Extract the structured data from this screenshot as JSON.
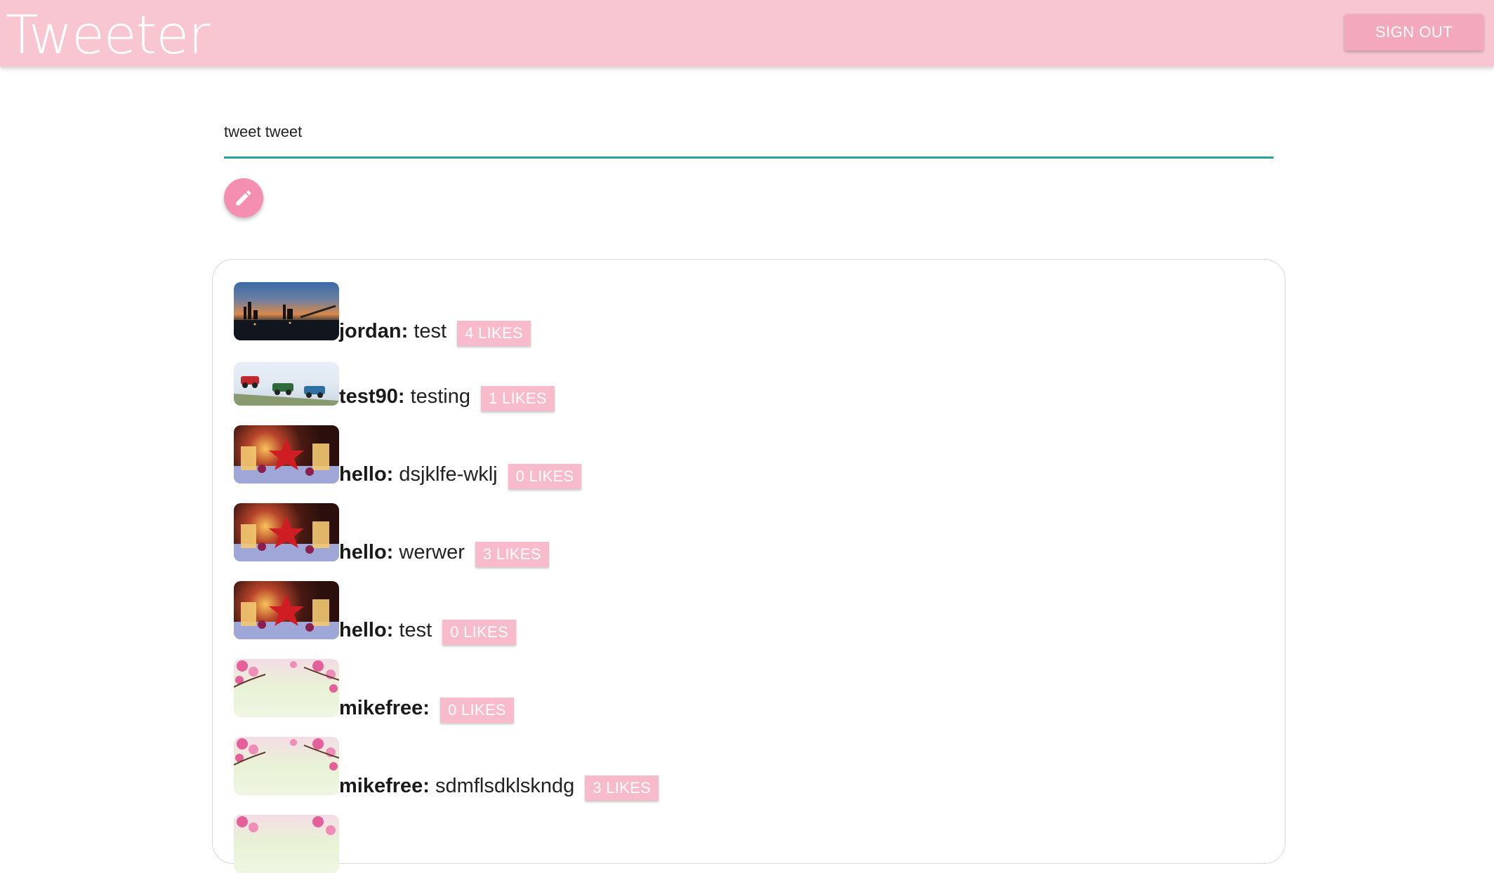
{
  "app": {
    "title": "Tweeter",
    "sign_out_label": "SIGN OUT"
  },
  "composer": {
    "value": "tweet tweet",
    "post_icon": "pencil-icon"
  },
  "feed": {
    "tweets": [
      {
        "user": "jordan:",
        "text": "test",
        "likes": "4 LIKES",
        "avatar": "city-night-image"
      },
      {
        "user": "test90:",
        "text": "testing",
        "likes": "1 LIKES",
        "avatar": "toy-cars-image"
      },
      {
        "user": "hello:",
        "text": "dsjklfe-wklj",
        "likes": "0 LIKES",
        "avatar": "christmas-image"
      },
      {
        "user": "hello:",
        "text": "werwer",
        "likes": "3 LIKES",
        "avatar": "christmas-image"
      },
      {
        "user": "hello:",
        "text": "test",
        "likes": "0 LIKES",
        "avatar": "christmas-image"
      },
      {
        "user": "mikefree:",
        "text": "",
        "likes": "0 LIKES",
        "avatar": "flowers-image"
      },
      {
        "user": "mikefree:",
        "text": "sdmflsdklskndg",
        "likes": "3 LIKES",
        "avatar": "flowers-image"
      }
    ]
  },
  "colors": {
    "appbar": "#f8c6d1",
    "button": "#f3a8bb",
    "fab": "#f48fb1",
    "likes_badge": "#f8bbcc",
    "input_underline": "#26a69a"
  }
}
